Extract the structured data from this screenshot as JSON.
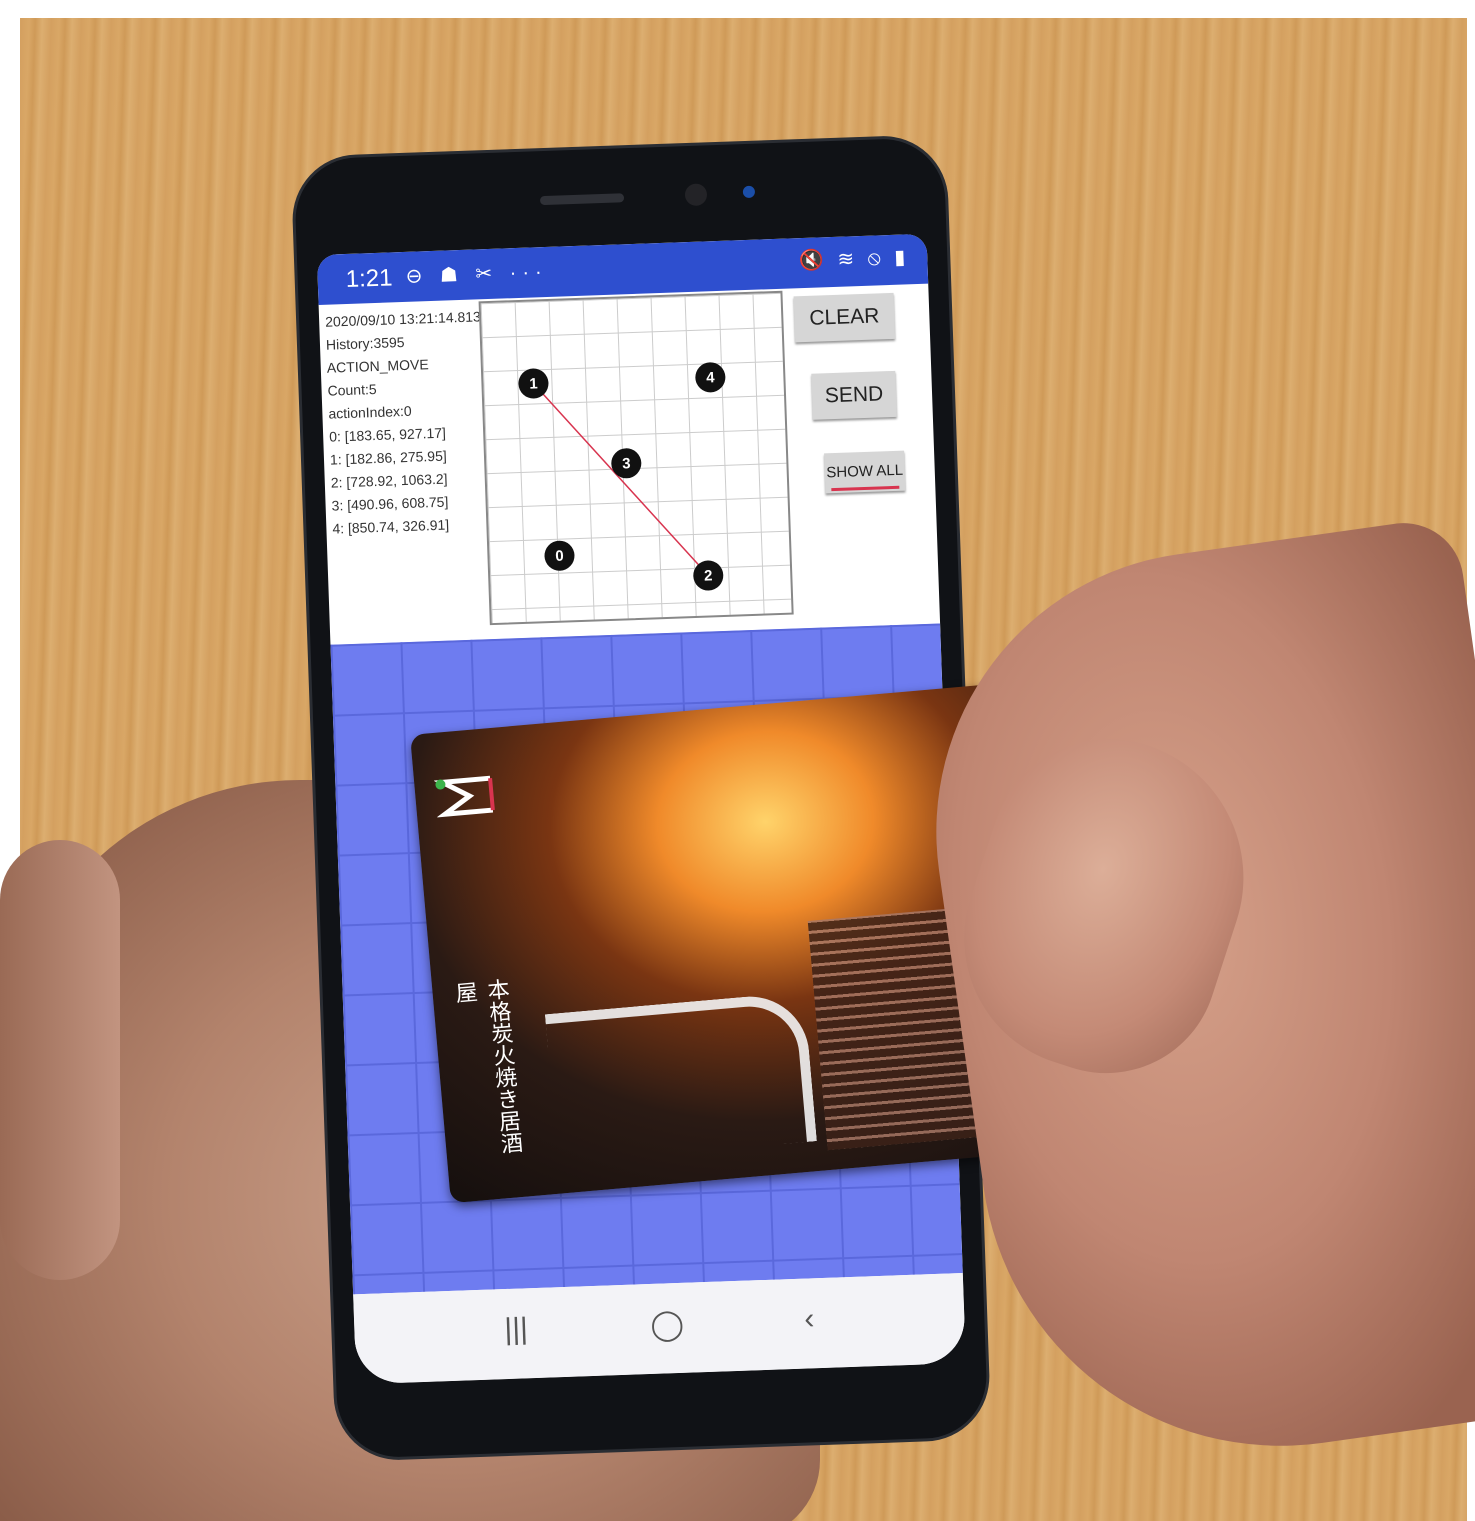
{
  "scene": {
    "description_colors": {
      "table": "#d9a766",
      "phone_body": "#101216",
      "statusbar": "#2e4fcf",
      "grid_bg": "#6e7cf0"
    }
  },
  "status_bar": {
    "time": "1:21",
    "left_icons": "⊖ ☗ ✂ ···",
    "right_icons": "🔇 ≋ ⦸ ▮"
  },
  "touch_log": {
    "timestamp": "2020/09/10 13:21:14.813",
    "lines": [
      "History:3595",
      "ACTION_MOVE",
      "Count:5",
      "actionIndex:0",
      "0: [183.65, 927.17]",
      "1: [182.86, 275.95]",
      "2: [728.92, 1063.2]",
      "3: [490.96, 608.75]",
      "4: [850.74, 326.91]"
    ]
  },
  "touch_points": [
    "0",
    "1",
    "2",
    "3",
    "4"
  ],
  "buttons": {
    "clear": "CLEAR",
    "send": "SEND",
    "show_all": "SHOW ALL"
  },
  "navbar": {
    "recents_icon": "|||",
    "home_icon": "◯",
    "back_icon": "‹"
  },
  "card": {
    "logo_text": "ML",
    "vertical_text": "本格炭火焼き居酒屋"
  }
}
